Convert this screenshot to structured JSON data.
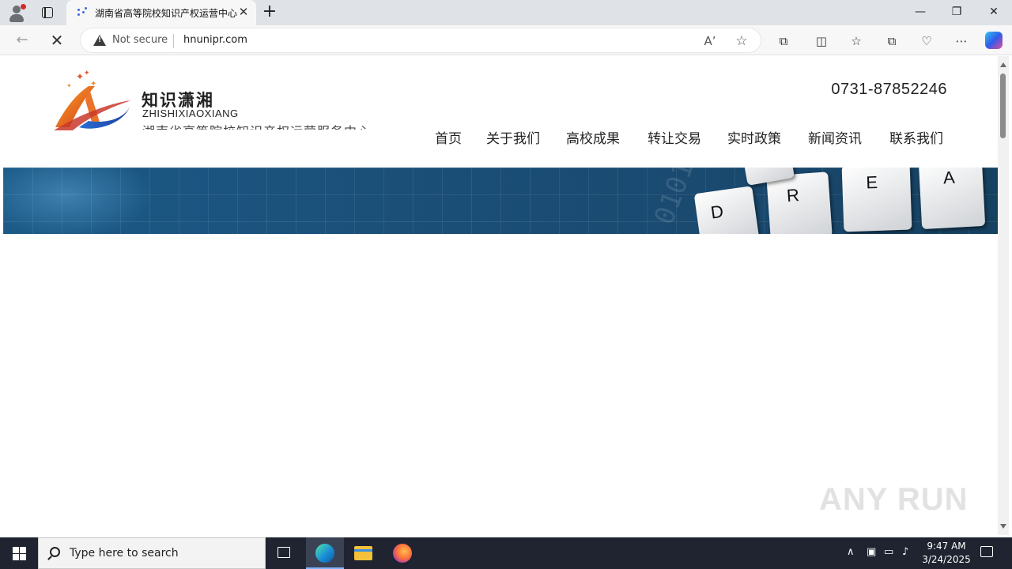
{
  "browser": {
    "tab_title": "湖南省高等院校知识产权运营中心",
    "tab_close": "✕",
    "new_tab": "+",
    "security_label": "Not secure",
    "url": "hnunipr.com",
    "window_controls": [
      "minimize-icon",
      "restore-icon",
      "close-icon"
    ]
  },
  "site": {
    "logo_cn": "知识潇湘",
    "logo_en": "ZHISHIXIAOXIANG",
    "logo_sub": "湖南省高等院校知识产权运营服务中心",
    "phone": "0731-87852246",
    "nav": [
      "首页",
      "关于我们",
      "高校成果",
      "转让交易",
      "实时政策",
      "新闻资讯",
      "联系我们"
    ],
    "banner_keys": [
      "D",
      "R",
      "E",
      "A"
    ]
  },
  "watermark": "ANY RUN",
  "taskbar": {
    "search_placeholder": "Type here to search",
    "time": "9:47 AM",
    "date": "3/24/2025"
  }
}
